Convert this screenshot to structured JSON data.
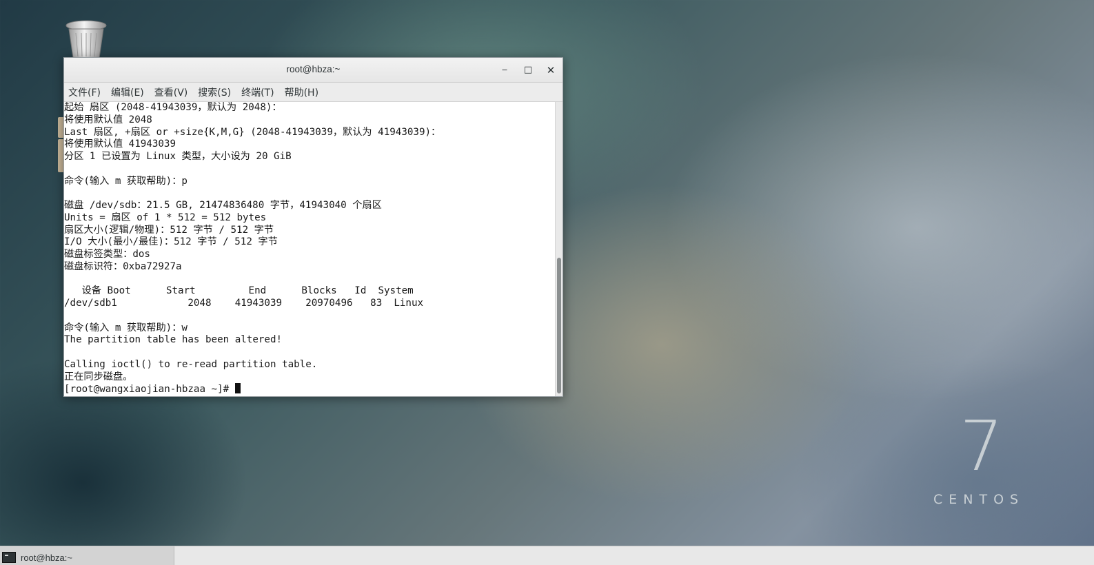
{
  "window": {
    "title": "root@hbza:~",
    "min_glyph": "‒",
    "max_glyph": "□",
    "close_glyph": "✕"
  },
  "menu": {
    "items": [
      "文件(F)",
      "编辑(E)",
      "查看(V)",
      "搜索(S)",
      "终端(T)",
      "帮助(H)"
    ]
  },
  "terminal": {
    "lines": [
      "起始 扇区 (2048-41943039，默认为 2048)：",
      "将使用默认值 2048",
      "Last 扇区, +扇区 or +size{K,M,G} (2048-41943039，默认为 41943039)：",
      "将使用默认值 41943039",
      "分区 1 已设置为 Linux 类型，大小设为 20 GiB",
      "",
      "命令(输入 m 获取帮助)：p",
      "",
      "磁盘 /dev/sdb：21.5 GB, 21474836480 字节，41943040 个扇区",
      "Units = 扇区 of 1 * 512 = 512 bytes",
      "扇区大小(逻辑/物理)：512 字节 / 512 字节",
      "I/O 大小(最小/最佳)：512 字节 / 512 字节",
      "磁盘标签类型：dos",
      "磁盘标识符：0xba72927a",
      "",
      "   设备 Boot      Start         End      Blocks   Id  System",
      "/dev/sdb1            2048    41943039    20970496   83  Linux",
      "",
      "命令(输入 m 获取帮助)：w",
      "The partition table has been altered!",
      "",
      "Calling ioctl() to re-read partition table.",
      "正在同步磁盘。"
    ],
    "prompt": "[root@wangxiaojian-hbzaa ~]# "
  },
  "branding": {
    "version": "7",
    "name": "CENTOS"
  },
  "taskbar": {
    "item_label": "root@hbza:~"
  },
  "icons": {
    "trash": "trash-icon",
    "terminal": "terminal-icon"
  }
}
